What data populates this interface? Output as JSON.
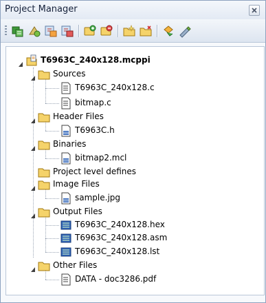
{
  "window": {
    "title": "Project Manager"
  },
  "toolbar": {
    "buttons": [
      "open-project-icon",
      "add-new-project-icon",
      "save-project-icon",
      "close-project-icon",
      "add-file-icon",
      "remove-file-icon",
      "new-folder-icon",
      "delete-folder-icon",
      "build-icon",
      "edit-settings-icon"
    ]
  },
  "tree": {
    "project": {
      "label": "T6963C_240x128.mcppi"
    },
    "sources": {
      "label": "Sources",
      "files": [
        "T6963C_240x128.c",
        "bitmap.c"
      ]
    },
    "header_files": {
      "label": "Header Files",
      "files": [
        "T6963C.h"
      ]
    },
    "binaries": {
      "label": "Binaries",
      "files": [
        "bitmap2.mcl"
      ]
    },
    "project_level_defines": {
      "label": "Project level defines"
    },
    "image_files": {
      "label": "Image Files",
      "files": [
        "sample.jpg"
      ]
    },
    "output_files": {
      "label": "Output Files",
      "files": [
        "T6963C_240x128.hex",
        "T6963C_240x128.asm",
        "T6963C_240x128.lst"
      ]
    },
    "other_files": {
      "label": "Other Files",
      "files": [
        "DATA - doc3286.pdf"
      ]
    }
  },
  "colors": {
    "folder": "#f5d36a",
    "accent": "#3b6fb6"
  }
}
